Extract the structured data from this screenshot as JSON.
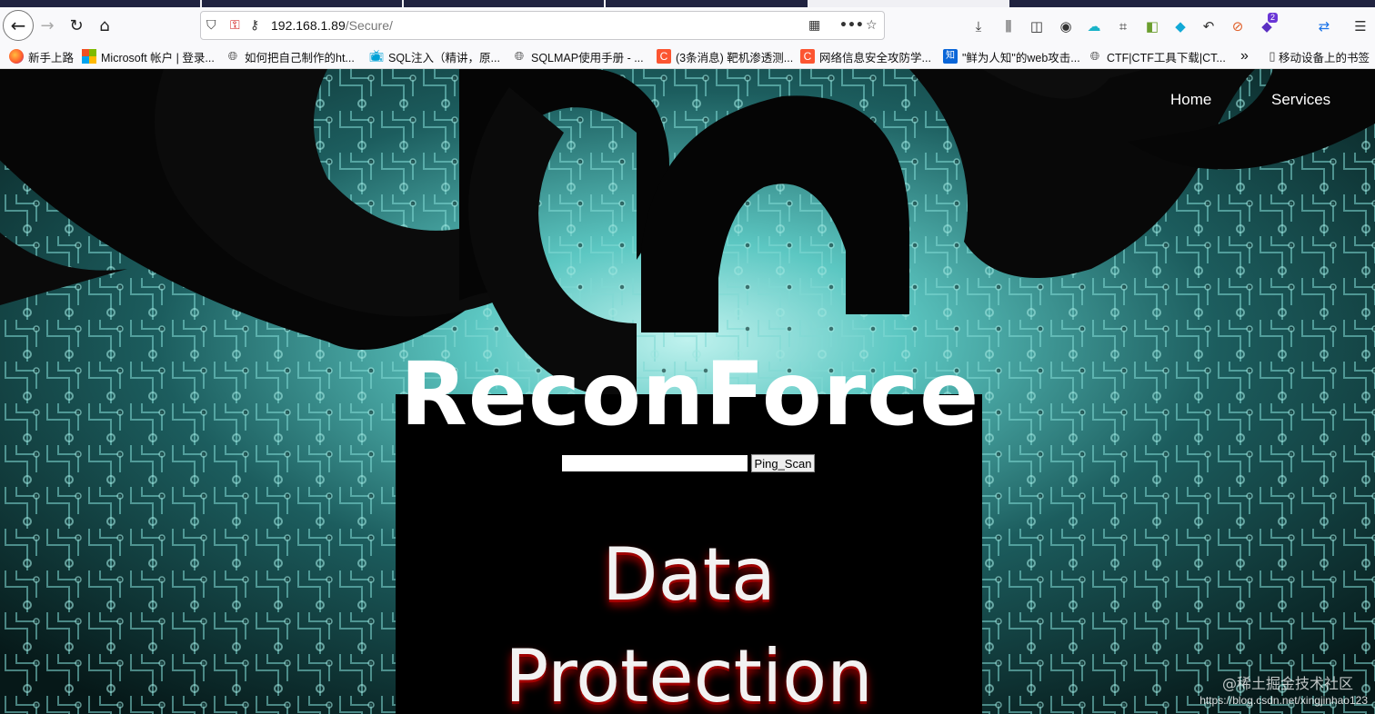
{
  "browser": {
    "url_host": "192.168.1.89",
    "url_path": "/Secure/",
    "badge_count": "2"
  },
  "bookmarks": [
    {
      "label": "新手上路",
      "icon": "firefox-icon"
    },
    {
      "label": "Microsoft 帐户 | 登录...",
      "icon": "microsoft-icon"
    },
    {
      "label": "如何把自己制作的ht...",
      "icon": "globe-icon"
    },
    {
      "label": "SQL注入（精讲，原...",
      "icon": "bilibili-icon"
    },
    {
      "label": "SQLMAP使用手册 - ...",
      "icon": "globe-icon"
    },
    {
      "label": "(3条消息) 靶机渗透测...",
      "icon": "csdn-icon"
    },
    {
      "label": "网络信息安全攻防学...",
      "icon": "csdn-icon"
    },
    {
      "label": "\"鲜为人知\"的web攻击...",
      "icon": "zhihu-icon"
    },
    {
      "label": "CTF|CTF工具下载|CT...",
      "icon": "globe-icon"
    },
    {
      "label": "移动设备上的书签",
      "icon": "mobile-icon"
    }
  ],
  "site": {
    "nav": [
      "Home",
      "Services"
    ],
    "title": "ReconForce",
    "ping_button": "Ping_Scan",
    "input_value": "",
    "hero_line1": "Data",
    "hero_line2": "Protection"
  },
  "watermark": {
    "line1": "@稀土掘金技术社区",
    "line2": "https://blog.csdn.net/xingjinhao123"
  },
  "colors": {
    "accent_teal": "#3fb8b4",
    "background_dark": "#000000"
  }
}
